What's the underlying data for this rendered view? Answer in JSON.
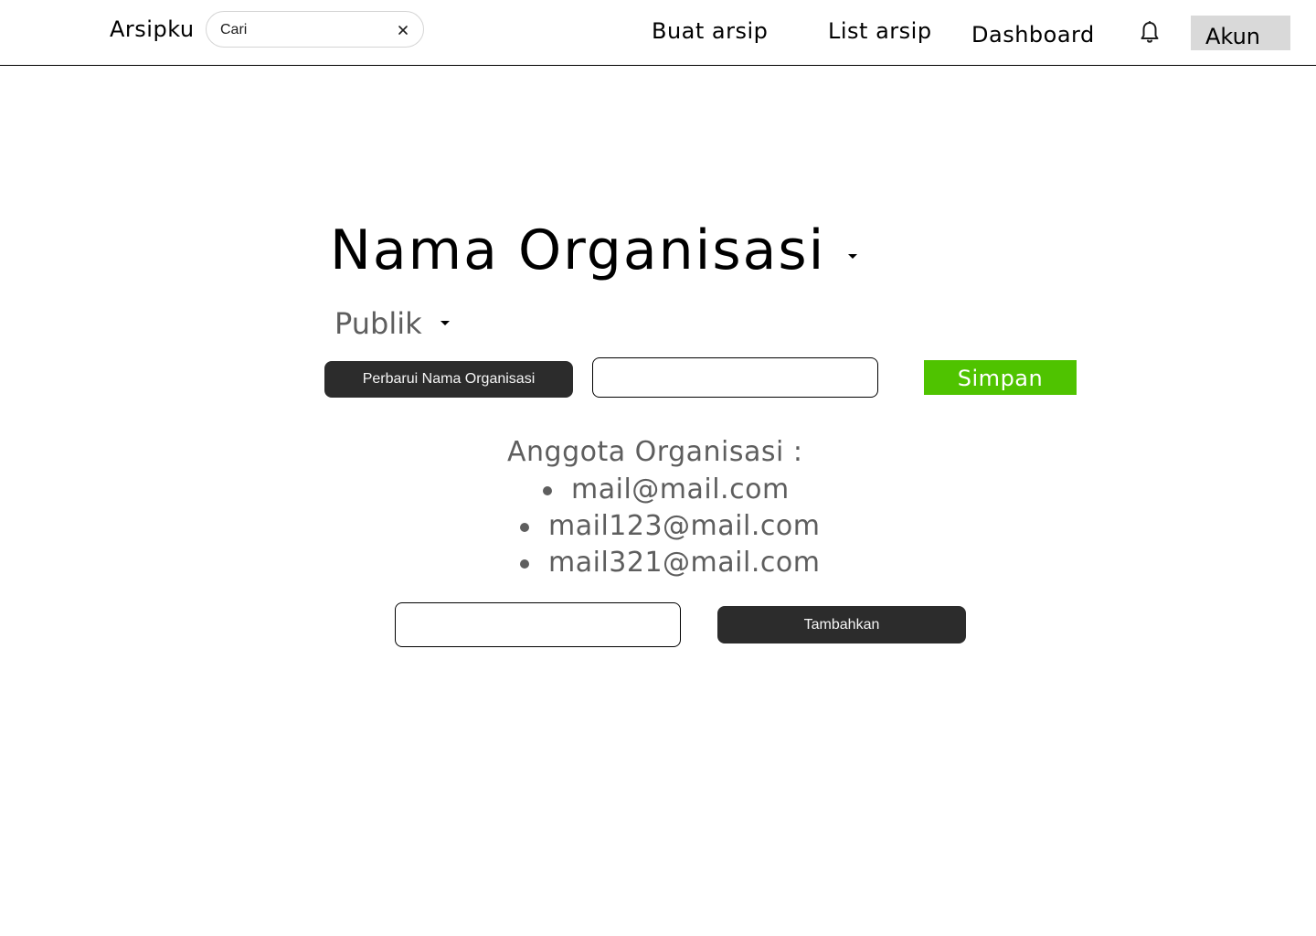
{
  "header": {
    "brand": "Arsipku",
    "search": {
      "value": "Cari",
      "clear_icon": "close-icon"
    },
    "nav": {
      "buat_arsip": "Buat arsip",
      "list_arsip": "List arsip",
      "dashboard": "Dashboard"
    },
    "notification_icon": "bell-icon",
    "account_label": "Akun"
  },
  "main": {
    "org_title": "Nama Organisasi",
    "visibility": "Publik",
    "rename_button": "Perbarui Nama Organisasi",
    "rename_input_value": "",
    "save_button": "Simpan",
    "members_heading": "Anggota Organisasi :",
    "members": [
      "mail@mail.com",
      "mail123@mail.com",
      "mail321@mail.com"
    ],
    "member_input_value": "",
    "add_button": "Tambahkan"
  },
  "colors": {
    "save_button": "#4fc300",
    "dark_button": "#2c2c2c",
    "account_button": "#d9d9d9",
    "muted_text": "#5e5e5e"
  }
}
